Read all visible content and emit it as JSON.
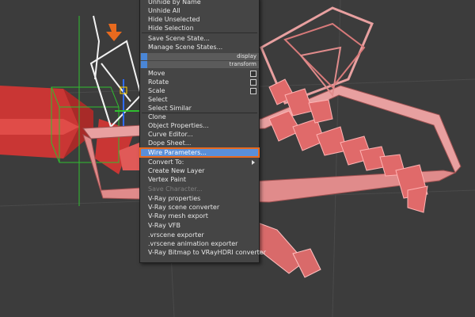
{
  "menu": {
    "items": [
      {
        "label": "Unhide by Name",
        "disabled": false
      },
      {
        "label": "Unhide All",
        "disabled": false
      },
      {
        "label": "Hide Unselected",
        "disabled": false
      },
      {
        "label": "Hide Selection",
        "disabled": false
      },
      {
        "label": "Save Scene State...",
        "disabled": false
      },
      {
        "label": "Manage Scene States...",
        "disabled": false
      },
      {
        "label": "Move",
        "disabled": false
      },
      {
        "label": "Rotate",
        "disabled": false
      },
      {
        "label": "Scale",
        "disabled": false
      },
      {
        "label": "Select",
        "disabled": false
      },
      {
        "label": "Select Similar",
        "disabled": false
      },
      {
        "label": "Clone",
        "disabled": false
      },
      {
        "label": "Object Properties...",
        "disabled": false
      },
      {
        "label": "Curve Editor...",
        "disabled": false
      },
      {
        "label": "Dope Sheet...",
        "disabled": false
      },
      {
        "label": "Wire Parameters...",
        "disabled": false,
        "highlighted": true
      },
      {
        "label": "Convert To:",
        "disabled": false
      },
      {
        "label": "Create New Layer",
        "disabled": false
      },
      {
        "label": "Vertex Paint",
        "disabled": false
      },
      {
        "label": "Save Character...",
        "disabled": true
      },
      {
        "label": "V-Ray properties",
        "disabled": false
      },
      {
        "label": "V-Ray scene converter",
        "disabled": false
      },
      {
        "label": "V-Ray mesh export",
        "disabled": false
      },
      {
        "label": "V-Ray VFB",
        "disabled": false
      },
      {
        "label": ".vrscene exporter",
        "disabled": false
      },
      {
        "label": ".vrscene animation exporter",
        "disabled": false
      },
      {
        "label": "V-Ray Bitmap to VRayHDRI converter",
        "disabled": false
      }
    ],
    "section_display": "display",
    "section_transform": "transform"
  },
  "colors": {
    "menu_bg": "#454545",
    "highlight": "#5a8fd8",
    "callout": "#e86a1e",
    "mesh_red": "#d9403e",
    "mesh_pink": "#e08b8b",
    "helper_green": "#2fbf2f",
    "viewport_bg": "#3c3c3c"
  },
  "icons": [
    "orange-arrow-icon",
    "submenu-arrow-icon",
    "settings-box-icon"
  ]
}
